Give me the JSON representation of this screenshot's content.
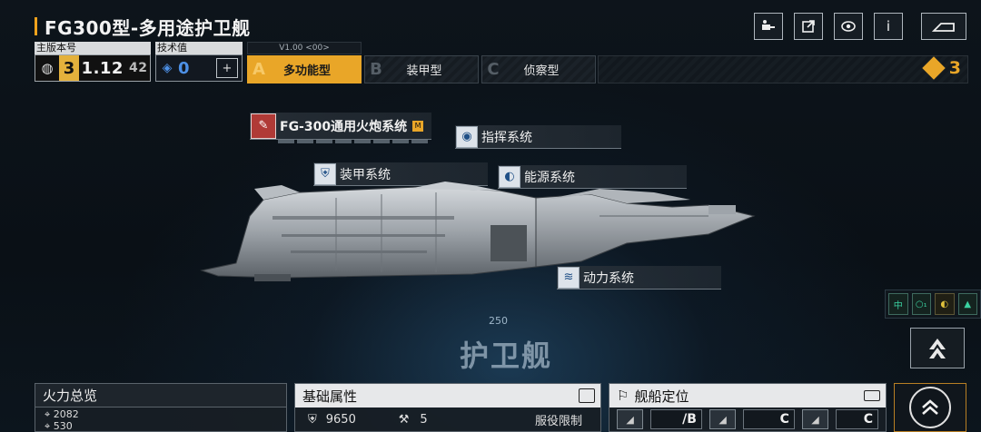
{
  "header": {
    "title": "FG300型-多用途护卫舰"
  },
  "top_icons": [
    "share-device-icon",
    "export-icon",
    "view-icon",
    "info-icon",
    "back-icon"
  ],
  "top_icon_glyphs": {
    "info": "i"
  },
  "version": {
    "label": "主版本号",
    "tier": "3",
    "main": "1.12",
    "sub": "42"
  },
  "tech": {
    "label": "技术值",
    "value": "0",
    "add": "+"
  },
  "modes": {
    "version_tag": "V1.00 <00>",
    "tabs": [
      {
        "letter": "A",
        "label": "多功能型"
      },
      {
        "letter": "B",
        "label": "装甲型"
      },
      {
        "letter": "C",
        "label": "侦察型"
      }
    ],
    "count": "3"
  },
  "systems": {
    "weapon": {
      "label": "FG-300通用火炮系统",
      "badge": "M"
    },
    "command": {
      "label": "指挥系统"
    },
    "armor": {
      "label": "装甲系统"
    },
    "energy": {
      "label": "能源系统"
    },
    "power": {
      "label": "动力系统"
    }
  },
  "emblem": {
    "number": "250",
    "class_name": "护卫舰"
  },
  "mini_tags": [
    "中",
    "○₁",
    "◐",
    "▲"
  ],
  "panels": {
    "firepower": {
      "title": "火力总览",
      "rows": [
        "2082",
        "530"
      ]
    },
    "base_attr": {
      "title": "基础属性",
      "hp": "9650",
      "armor": "5",
      "service": "服役限制"
    },
    "positioning": {
      "title": "舰船定位",
      "slots": [
        "/B",
        "C",
        "C"
      ]
    }
  }
}
